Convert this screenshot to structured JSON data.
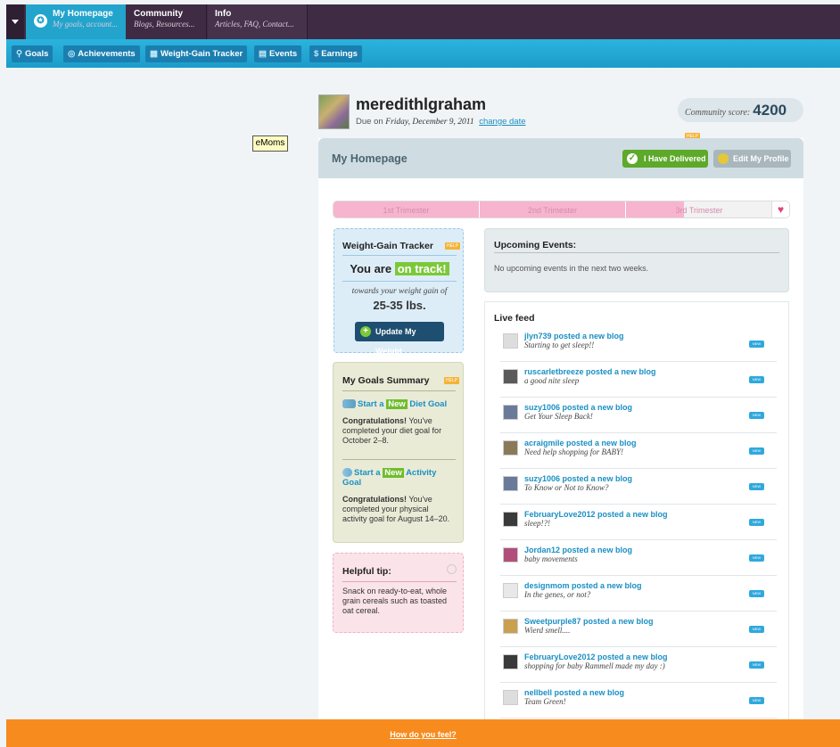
{
  "topnav": {
    "tabs": [
      {
        "title": "My Homepage",
        "subtitle": "My goals, account..."
      },
      {
        "title": "Community",
        "subtitle": "Blogs, Resources..."
      },
      {
        "title": "Info",
        "subtitle": "Articles, FAQ, Contact..."
      }
    ]
  },
  "subnav": {
    "items": [
      {
        "label": "Goals",
        "icon": "pin-icon"
      },
      {
        "label": "Achievements",
        "icon": "badge-icon"
      },
      {
        "label": "Weight-Gain Tracker",
        "icon": "chart-icon"
      },
      {
        "label": "Events",
        "icon": "calendar-icon"
      },
      {
        "label": "Earnings",
        "icon": "dollar-icon"
      }
    ]
  },
  "tooltip": "eMoms",
  "profile": {
    "username": "meredithlgraham",
    "due_prefix": "Due on",
    "due_date": "Friday, December 9, 2011",
    "change_date": "change date",
    "score_label": "Community score:",
    "score_value": "4200",
    "help_label": "HELP"
  },
  "homepage": {
    "title": "My Homepage",
    "delivered_button": "I Have Delivered",
    "edit_button": "Edit My Profile"
  },
  "trimester": {
    "segments": [
      "1st Trimester",
      "2nd Trimester",
      "3rd Trimester"
    ],
    "progress": 0.77
  },
  "weight_tracker": {
    "title": "Weight-Gain Tracker",
    "status_prefix": "You are",
    "status_value": "on track!",
    "subtitle": "towards your weight gain of",
    "range": "25-35 lbs.",
    "button": "Update My Weight"
  },
  "goals_summary": {
    "title": "My Goals Summary",
    "start_word": "Start a",
    "new_word": "New",
    "diet_goal": "Diet Goal",
    "diet_congrats": "Congratulations!",
    "diet_text": "You've completed your diet goal for October 2–8.",
    "activity_goal": "Activity Goal",
    "activity_congrats": "Congratulations!",
    "activity_text": "You've completed your physical activity goal for August 14–20."
  },
  "tip": {
    "title": "Helpful tip:",
    "text": "Snack on ready-to-eat, whole grain cereals such as toasted oat cereal."
  },
  "events": {
    "title": "Upcoming Events:",
    "empty_text": "No upcoming events in the next two weeks."
  },
  "feed": {
    "title": "Live feed",
    "new_badge": "NEW",
    "items": [
      {
        "headline": "jlyn739 posted a new blog",
        "subtitle": "Starting to get sleep!!"
      },
      {
        "headline": "ruscarletbreeze posted a new blog",
        "subtitle": "a good nite sleep"
      },
      {
        "headline": "suzy1006 posted a new blog",
        "subtitle": "Get Your Sleep Back!"
      },
      {
        "headline": "acraigmile posted a new blog",
        "subtitle": "Need help shopping for BABY!"
      },
      {
        "headline": "suzy1006 posted a new blog",
        "subtitle": "To Know or Not to Know?"
      },
      {
        "headline": "FebruaryLove2012 posted a new blog",
        "subtitle": "sleep!?!"
      },
      {
        "headline": "Jordan12 posted a new blog",
        "subtitle": "baby movements"
      },
      {
        "headline": "designmom posted a new blog",
        "subtitle": "In the genes, or not?"
      },
      {
        "headline": "Sweetpurple87 posted a new blog",
        "subtitle": "Wierd smell...."
      },
      {
        "headline": "FebruaryLove2012 posted a new blog",
        "subtitle": "shopping for baby Rammell made my day :)"
      },
      {
        "headline": "nellbell posted a new blog",
        "subtitle": "Team Green!"
      }
    ]
  },
  "footer": {
    "link": "How do you feel?"
  },
  "colors": {
    "topbar": "#3f2b44",
    "accent": "#22a4cd",
    "green": "#5da92a",
    "footer": "#f78b1e",
    "trimester_fill": "#f7b4cf"
  }
}
